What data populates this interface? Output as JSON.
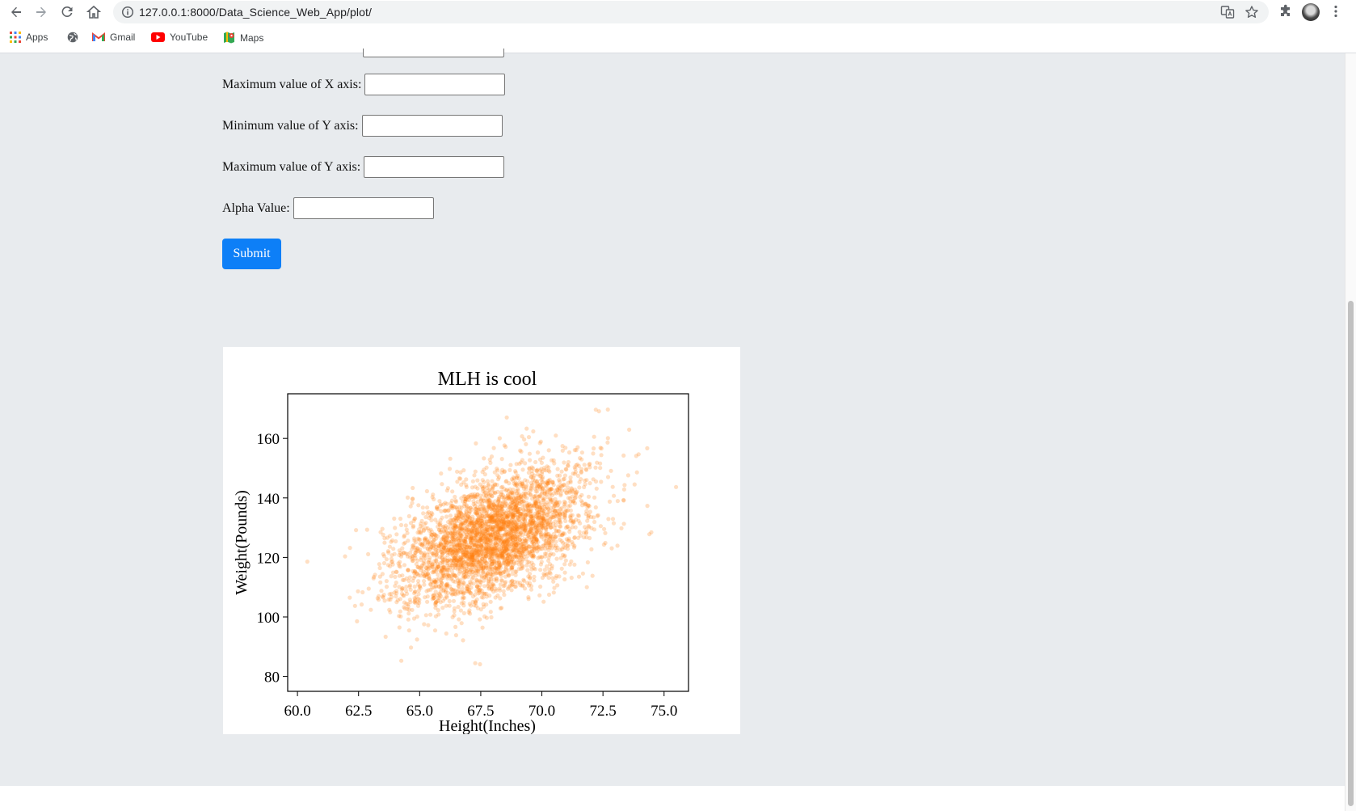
{
  "browser": {
    "url": "127.0.0.1:8000/Data_Science_Web_App/plot/",
    "bookmarks": [
      {
        "label": "Apps",
        "icon": "apps-grid-icon"
      },
      {
        "label": "",
        "icon": "globe-icon"
      },
      {
        "label": "Gmail",
        "icon": "gmail-icon"
      },
      {
        "label": "YouTube",
        "icon": "youtube-icon"
      },
      {
        "label": "Maps",
        "icon": "maps-icon"
      }
    ]
  },
  "form": {
    "max_x_label": "Maximum value of X axis:",
    "min_y_label": "Minimum value of Y axis:",
    "max_y_label": "Maximum value of Y axis:",
    "alpha_label": "Alpha Value:",
    "max_x_value": "",
    "min_y_value": "",
    "max_y_value": "",
    "alpha_value": "",
    "submit_label": "Submit"
  },
  "colors": {
    "accent": "#0d7ff7",
    "page_bg": "#e8ebee",
    "point": "#ff7f0e"
  },
  "chart_data": {
    "type": "scatter",
    "title": "MLH is cool",
    "xlabel": "Height(Inches)",
    "ylabel": "Weight(Pounds)",
    "xlim": [
      59.6,
      76.0
    ],
    "ylim": [
      75.0,
      175.0
    ],
    "xticks": [
      "60.0",
      "62.5",
      "65.0",
      "67.5",
      "70.0",
      "72.5",
      "75.0"
    ],
    "yticks": [
      "80",
      "100",
      "120",
      "140",
      "160"
    ],
    "grid": false,
    "legend": "none",
    "alpha": 0.25,
    "distribution": {
      "n": 10000,
      "mean_x": 67.99,
      "std_x": 1.9,
      "mean_y": 127.08,
      "std_y": 11.66,
      "correlation": 0.5
    }
  }
}
